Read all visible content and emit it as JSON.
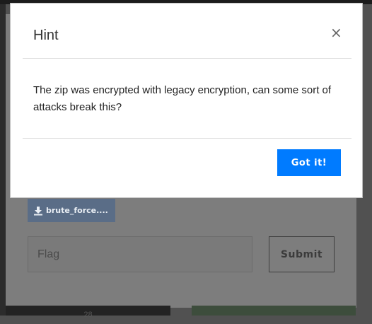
{
  "modal": {
    "title": "Hint",
    "close_glyph": "×",
    "body": "The zip was encrypted with legacy encryption, can some sort of attacks break this?",
    "confirm_label": "Got it!"
  },
  "challenge": {
    "file_label": "brute_force....",
    "file_icon": "download-icon",
    "flag_placeholder": "Flag",
    "submit_label": "Submit"
  },
  "footer": {
    "left_text": "28"
  },
  "colors": {
    "primary": "#007bff",
    "file_button": "#5a6d87",
    "overlay": "#515151"
  }
}
